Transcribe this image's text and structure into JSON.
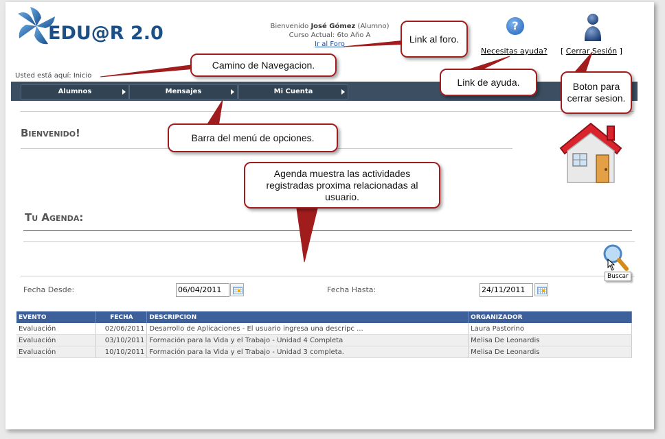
{
  "header": {
    "logo_text": "EDU@R 2.0",
    "welcome_prefix": "Bienvenido",
    "user_name": "José Gómez",
    "user_role": "(Alumno)",
    "current_course": "Curso Actual: 6to Año A",
    "forum_link": "Ir al Foro",
    "help_icon_glyph": "?",
    "help_link": "Necesitas ayuda?",
    "logout_open": "[",
    "logout_link": "Cerrar Sesión",
    "logout_close": "]"
  },
  "breadcrumb": "Usted está aquí: Inicio",
  "menu": {
    "items": [
      {
        "label": "Alumnos"
      },
      {
        "label": "Mensajes"
      },
      {
        "label": "Mi Cuenta"
      }
    ]
  },
  "welcome_heading": "Bienvenido!",
  "agenda": {
    "heading": "Tu Agenda:",
    "search_tooltip": "Buscar",
    "fecha_desde_label": "Fecha Desde:",
    "fecha_desde_value": "06/04/2011",
    "fecha_hasta_label": "Fecha Hasta:",
    "fecha_hasta_value": "24/11/2011",
    "columns": [
      "EVENTO",
      "FECHA",
      "DESCRIPCION",
      "ORGANIZADOR"
    ],
    "rows": [
      {
        "evento": "Evaluación",
        "fecha": "02/06/2011",
        "descripcion": "Desarrollo de Aplicaciones - El usuario ingresa una descripc ...",
        "organizador": "Laura Pastorino"
      },
      {
        "evento": "Evaluación",
        "fecha": "03/10/2011",
        "descripcion": "Formación para la Vida y el Trabajo - Unidad 4 Completa",
        "organizador": "Melisa De Leonardis"
      },
      {
        "evento": "Evaluación",
        "fecha": "10/10/2011",
        "descripcion": "Formación para la Vida y el Trabajo - Unidad 3 completa.",
        "organizador": "Melisa De Leonardis"
      }
    ]
  },
  "callouts": {
    "forum": "Link al foro.",
    "navigation": "Camino de Navegacion.",
    "help": "Link de ayuda.",
    "logout": "Boton para cerrar sesion.",
    "menubar": "Barra del menú de opciones.",
    "agenda": "Agenda muestra las actividades registradas proxima relacionadas al usuario."
  },
  "colors": {
    "menubar": "#3c4f62",
    "table_header": "#3d5f9a",
    "callout_border": "#a11d1d",
    "logo_blue": "#1b4f86"
  },
  "icons": [
    "logo-star-icon",
    "help-icon",
    "user-icon",
    "house-icon",
    "search-icon",
    "calendar-icon",
    "menu-arrow-icon"
  ]
}
